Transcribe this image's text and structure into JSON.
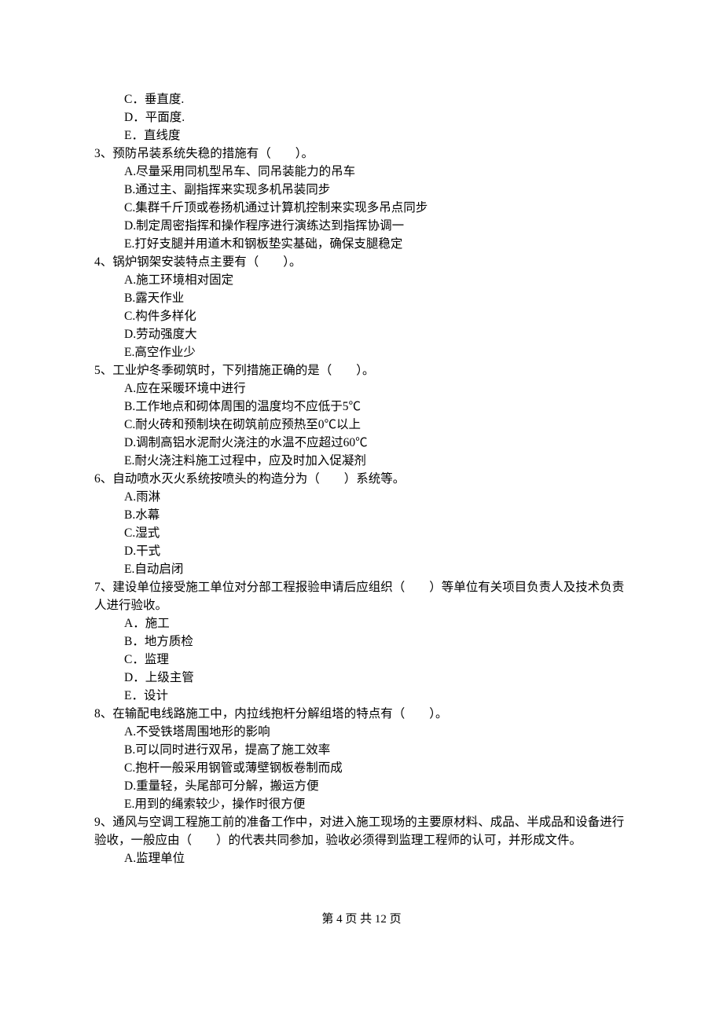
{
  "q2_tail": {
    "opt_c": "C．垂直度.",
    "opt_d": "D．平面度.",
    "opt_e": "E．直线度"
  },
  "q3": {
    "stem": "3、预防吊装系统失稳的措施有（　　）。",
    "a": "A.尽量采用同机型吊车、同吊装能力的吊车",
    "b": "B.通过主、副指挥来实现多机吊装同步",
    "c": "C.集群千斤顶或卷扬机通过计算机控制来实现多吊点同步",
    "d": "D.制定周密指挥和操作程序进行演练达到指挥协调一",
    "e": "E.打好支腿并用道木和钢板垫实基础，确保支腿稳定"
  },
  "q4": {
    "stem": "4、锅炉钢架安装特点主要有（　　）。",
    "a": "A.施工环境相对固定",
    "b": "B.露天作业",
    "c": "C.构件多样化",
    "d": "D.劳动强度大",
    "e": "E.高空作业少"
  },
  "q5": {
    "stem": "5、工业炉冬季砌筑时，下列措施正确的是（　　）。",
    "a": "A.应在采暖环境中进行",
    "b": "B.工作地点和砌体周围的温度均不应低于5℃",
    "c": "C.耐火砖和预制块在砌筑前应预热至0℃以上",
    "d": "D.调制高铝水泥耐火浇注的水温不应超过60℃",
    "e": "E.耐火浇注料施工过程中，应及时加入促凝剂"
  },
  "q6": {
    "stem": "6、自动喷水灭火系统按喷头的构造分为（　　）系统等。",
    "a": "A.雨淋",
    "b": "B.水幕",
    "c": "C.湿式",
    "d": "D.干式",
    "e": "E.自动启闭"
  },
  "q7": {
    "stem": "7、建设单位接受施工单位对分部工程报验申请后应组织（　　）等单位有关项目负责人及技术负责人进行验收。",
    "a": "A．施工",
    "b": "B．地方质检",
    "c": "C．监理",
    "d": "D．上级主管",
    "e": "E．设计"
  },
  "q8": {
    "stem": "8、在输配电线路施工中，内拉线抱杆分解组塔的特点有（　　）。",
    "a": "A.不受铁塔周围地形的影响",
    "b": "B.可以同时进行双吊，提高了施工效率",
    "c": "C.抱杆一般采用钢管或薄壁钢板卷制而成",
    "d": "D.重量轻，头尾部可分解，搬运方便",
    "e": "E.用到的绳索较少，操作时很方便"
  },
  "q9": {
    "stem": "9、通风与空调工程施工前的准备工作中，对进入施工现场的主要原材料、成品、半成品和设备进行验收，一般应由（　　）的代表共同参加，验收必须得到监理工程师的认可，并形成文件。",
    "a": "A.监理单位"
  },
  "footer": "第 4 页 共 12 页"
}
